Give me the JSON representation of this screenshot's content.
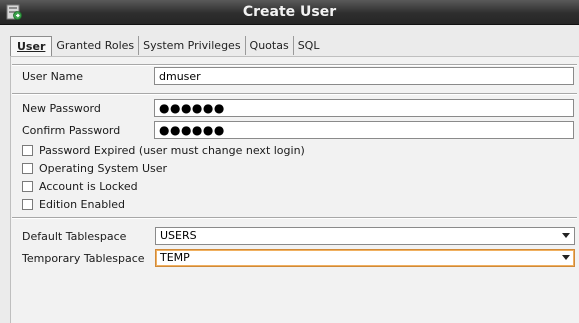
{
  "window": {
    "title": "Create User",
    "icon": "create-user-app-icon"
  },
  "tabs": [
    {
      "label": "User",
      "selected": true
    },
    {
      "label": "Granted Roles",
      "selected": false
    },
    {
      "label": "System Privileges",
      "selected": false
    },
    {
      "label": "Quotas",
      "selected": false
    },
    {
      "label": "SQL",
      "selected": false
    }
  ],
  "form": {
    "user_name": {
      "label": "User Name",
      "value": "dmuser"
    },
    "new_password": {
      "label": "New Password",
      "value": "●●●●●●"
    },
    "confirm_password": {
      "label": "Confirm Password",
      "value": "●●●●●●"
    },
    "checkboxes": [
      {
        "label": "Password Expired (user must change next login)",
        "checked": false
      },
      {
        "label": "Operating System User",
        "checked": false
      },
      {
        "label": "Account is Locked",
        "checked": false
      },
      {
        "label": "Edition Enabled",
        "checked": false
      }
    ],
    "default_tablespace": {
      "label": "Default Tablespace",
      "value": "USERS"
    },
    "temporary_tablespace": {
      "label": "Temporary Tablespace",
      "value": "TEMP"
    }
  },
  "colors": {
    "titlebar": "#2e2e2e",
    "focus_border": "#d08a3a"
  }
}
